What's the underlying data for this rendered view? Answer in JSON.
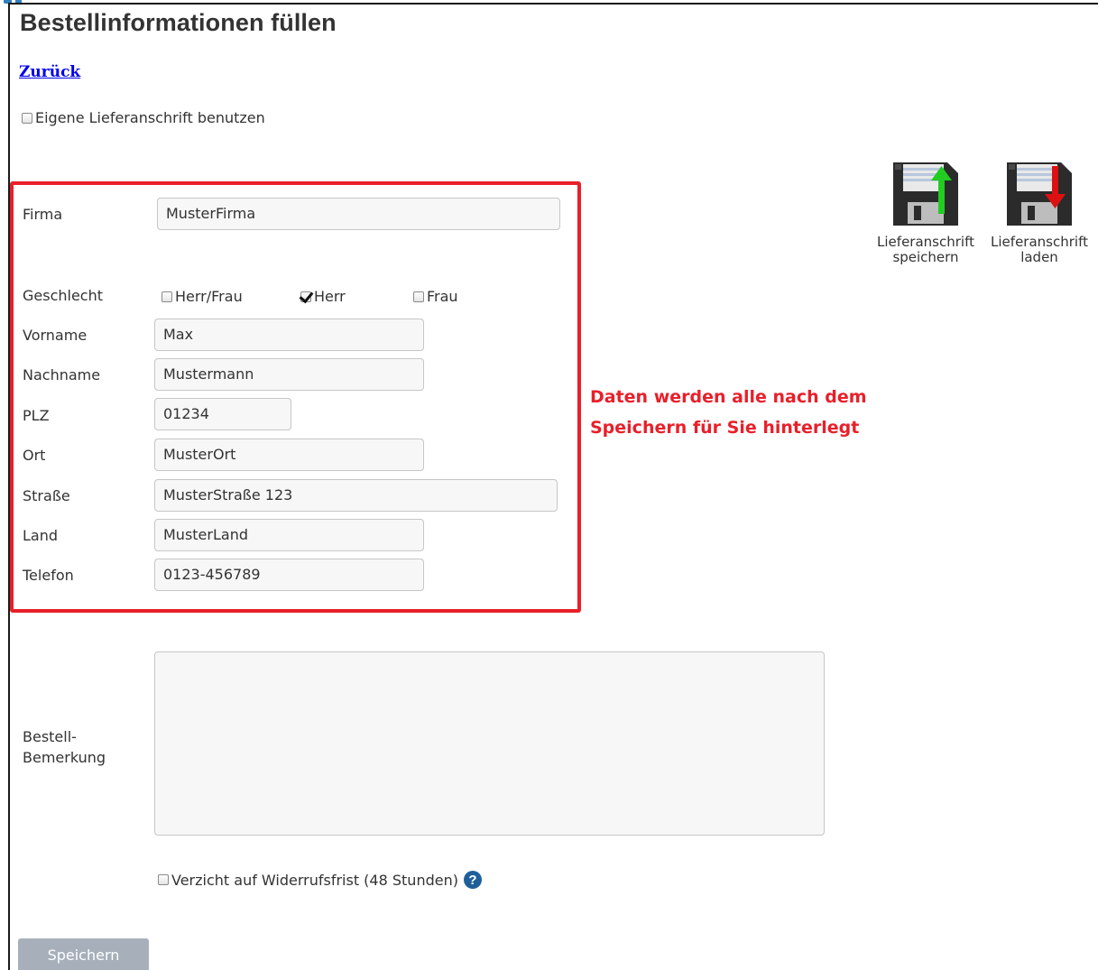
{
  "page": {
    "title": "Bestellinformationen füllen",
    "back_link": "Zurück"
  },
  "own_address": {
    "label": "Eigene Lieferanschrift benutzen",
    "checked": false
  },
  "toolbar": {
    "save_address_label_line1": "Lieferanschrift",
    "save_address_label_line2": "speichern",
    "save_address_icon": "floppy-disk-upload-icon",
    "load_address_label_line1": "Lieferanschrift",
    "load_address_label_line2": "laden",
    "load_address_icon": "floppy-disk-download-icon"
  },
  "form": {
    "firma": {
      "label": "Firma",
      "value": "MusterFirma"
    },
    "geschlecht": {
      "label": "Geschlecht",
      "options": [
        {
          "label": "Herr/Frau",
          "checked": false
        },
        {
          "label": "Herr",
          "checked": true
        },
        {
          "label": "Frau",
          "checked": false
        }
      ]
    },
    "vorname": {
      "label": "Vorname",
      "value": "Max"
    },
    "nachname": {
      "label": "Nachname",
      "value": "Mustermann"
    },
    "plz": {
      "label": "PLZ",
      "value": "01234"
    },
    "ort": {
      "label": "Ort",
      "value": "MusterOrt"
    },
    "strasse": {
      "label": "Straße",
      "value": "MusterStraße 123"
    },
    "land": {
      "label": "Land",
      "value": "MusterLand"
    },
    "telefon": {
      "label": "Telefon",
      "value": "0123-456789"
    },
    "bemerkung": {
      "label_line1": "Bestell-",
      "label_line2": "Bemerkung",
      "value": ""
    }
  },
  "annotation": {
    "line1": "Daten werden alle nach dem",
    "line2": "Speichern für Sie hinterlegt",
    "color": "#e8202a"
  },
  "widerruf": {
    "label": "Verzicht auf Widerrufsfrist (48 Stunden)",
    "checked": false,
    "help_glyph": "?"
  },
  "save_button_label": "Speichern",
  "colors": {
    "highlight": "#e8202a",
    "link": "#0000ee",
    "button": "#a7b0ba",
    "help_icon": "#1f5f99",
    "arrow_up": "#22cc22",
    "arrow_down": "#dd1111"
  }
}
